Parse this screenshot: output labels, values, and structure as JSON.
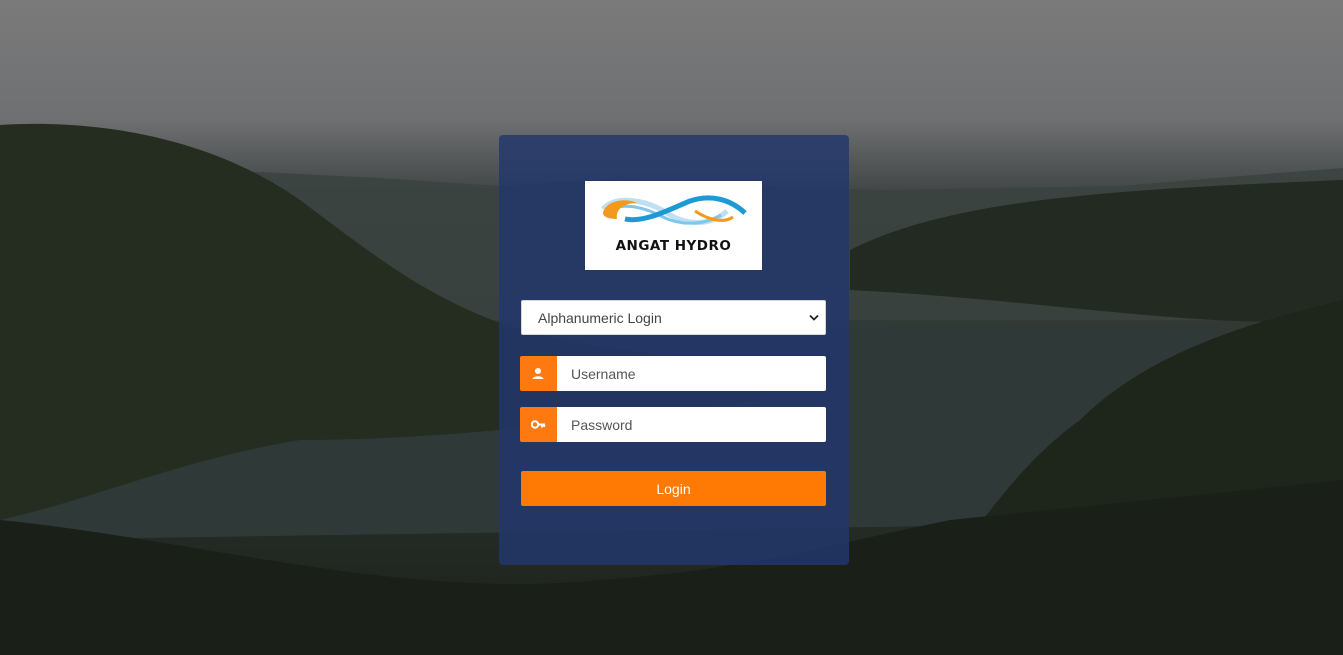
{
  "logo": {
    "text": "ANGAT HYDRO"
  },
  "login_form": {
    "login_type": {
      "selected": "Alphanumeric Login"
    },
    "username": {
      "placeholder": "Username",
      "value": ""
    },
    "password": {
      "placeholder": "Password",
      "value": ""
    },
    "submit_label": "Login"
  },
  "icons": {
    "username": "user-icon",
    "password": "key-icon",
    "select": "chevron-down-icon"
  },
  "colors": {
    "accent": "#fe7a05",
    "card": "#22376e",
    "logo_orange": "#f39a1c",
    "logo_blue": "#1d9ad6"
  }
}
